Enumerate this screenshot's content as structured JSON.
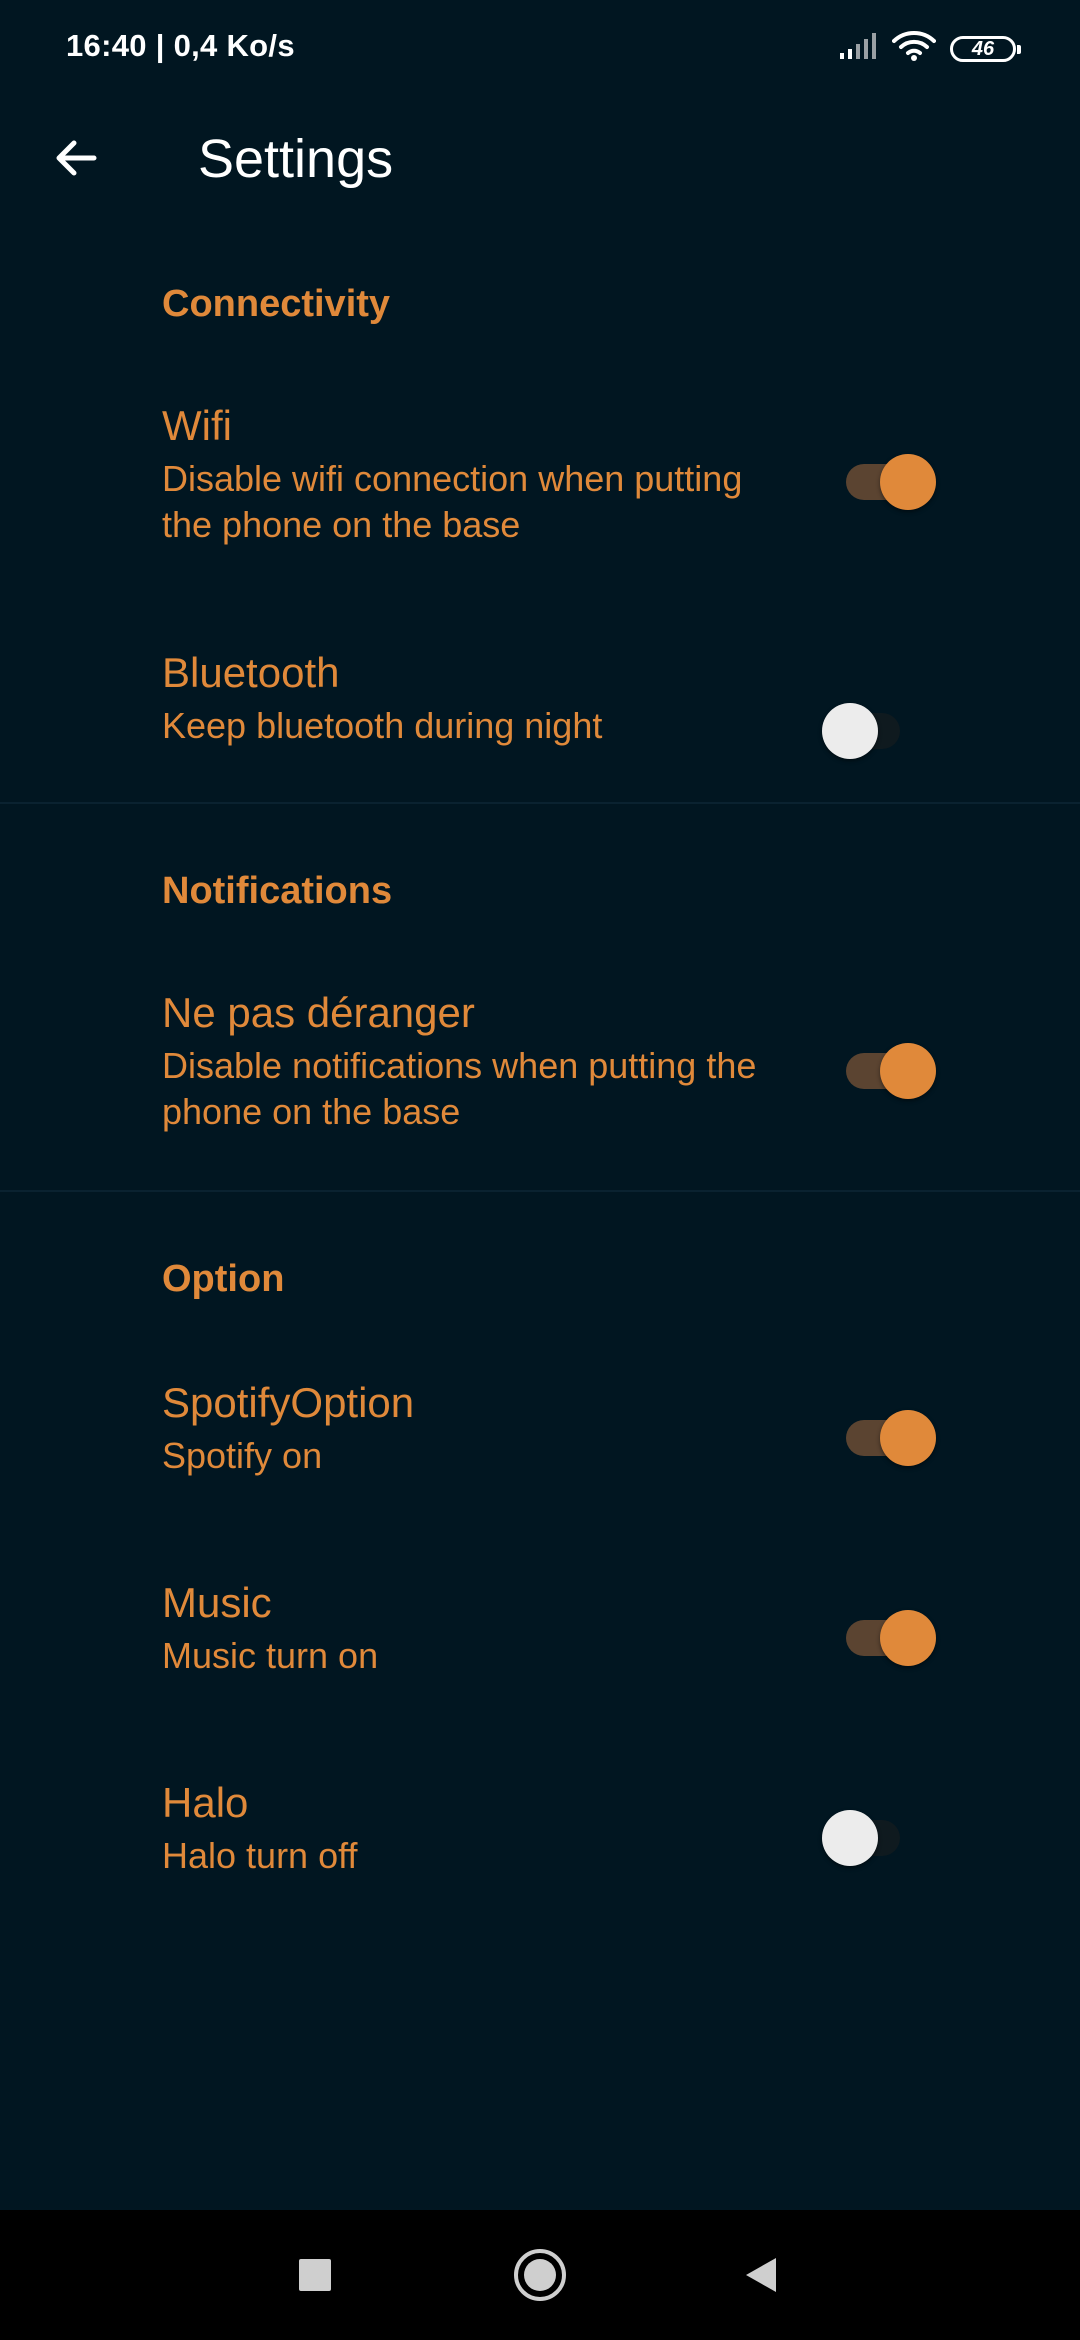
{
  "status_bar": {
    "time_speed": "16:40 | 0,4 Ko/s",
    "battery": "46"
  },
  "app_bar": {
    "title": "Settings"
  },
  "sections": [
    {
      "header": "Connectivity",
      "items": [
        {
          "title": "Wifi",
          "summary": "Disable wifi connection when putting the phone on the base",
          "checked": true
        },
        {
          "title": "Bluetooth",
          "summary": "Keep bluetooth during night",
          "checked": false
        }
      ]
    },
    {
      "header": "Notifications",
      "items": [
        {
          "title": "Ne pas déranger",
          "summary": "Disable notifications when putting the phone on the base",
          "checked": true
        }
      ]
    },
    {
      "header": "Option",
      "items": [
        {
          "title": "SpotifyOption",
          "summary": "Spotify on",
          "checked": true
        },
        {
          "title": "Music",
          "summary": "Music turn on",
          "checked": true
        },
        {
          "title": "Halo",
          "summary": "Halo turn off",
          "checked": false
        }
      ]
    }
  ],
  "colors": {
    "background": "#011621",
    "accent": "#e0893a",
    "title_text": "#ffffff"
  },
  "icons": {
    "back": "arrow-left-icon",
    "signal": "signal-icon",
    "wifi": "wifi-icon",
    "battery": "battery-icon",
    "nav_recents": "square-icon",
    "nav_home": "circle-icon",
    "nav_back": "triangle-back-icon"
  }
}
